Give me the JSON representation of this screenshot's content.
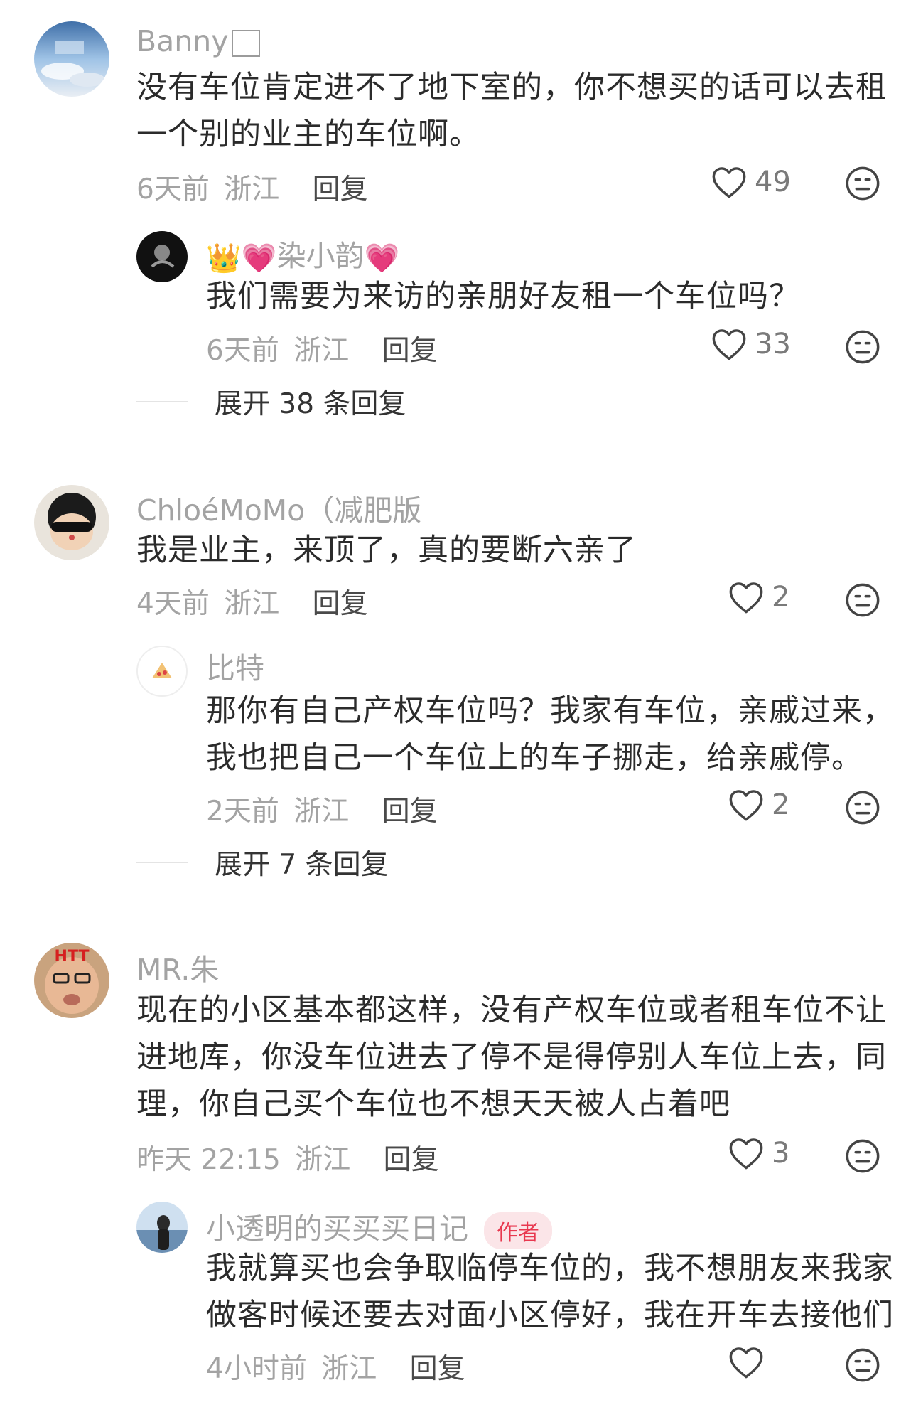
{
  "comments": [
    {
      "username": "Banny",
      "text_lines": [
        "没有车位肯定进不了地下室的，你不想买的话可以去租",
        "一个别的业主的车位啊。"
      ],
      "time": "6天前",
      "region": "浙江",
      "reply_label": "回复",
      "likes": "49",
      "reply": {
        "username": "染小韵",
        "text_lines": [
          "我们需要为来访的亲朋好友租一个车位吗？"
        ],
        "time": "6天前",
        "region": "浙江",
        "reply_label": "回复",
        "likes": "33"
      },
      "expand_label": "展开 38 条回复"
    },
    {
      "username": "ChloéMoMo（减肥版",
      "text_lines": [
        "我是业主，来顶了，真的要断六亲了"
      ],
      "time": "4天前",
      "region": "浙江",
      "reply_label": "回复",
      "likes": "2",
      "reply": {
        "username": "比特",
        "text_lines": [
          "那你有自己产权车位吗？我家有车位，亲戚过来，",
          "我也把自己一个车位上的车子挪走，给亲戚停。"
        ],
        "time": "2天前",
        "region": "浙江",
        "reply_label": "回复",
        "likes": "2"
      },
      "expand_label": "展开 7 条回复"
    },
    {
      "username": "MR.朱",
      "text_lines": [
        "现在的小区基本都这样，没有产权车位或者租车位不让",
        "进地库，你没车位进去了停不是得停别人车位上去，同",
        "理，你自己买个车位也不想天天被人占着吧"
      ],
      "time": "昨天 22:15",
      "region": "浙江",
      "reply_label": "回复",
      "likes": "3",
      "reply": {
        "username": "小透明的买买买日记",
        "badge": "作者",
        "text_lines": [
          "我就算买也会争取临停车位的，我不想朋友来我家",
          "做客时候还要去对面小区停好，我在开车去接他们"
        ],
        "time": "4小时前",
        "region": "浙江",
        "reply_label": "回复",
        "likes": ""
      }
    }
  ],
  "icons": {
    "like": "heart-outline-icon",
    "dislike": "meh-face-icon"
  },
  "colors": {
    "username": "#a3a3a3",
    "text": "#2b2b2b",
    "author_badge_bg": "#fbe5e8",
    "author_badge_text": "#e8384f"
  }
}
